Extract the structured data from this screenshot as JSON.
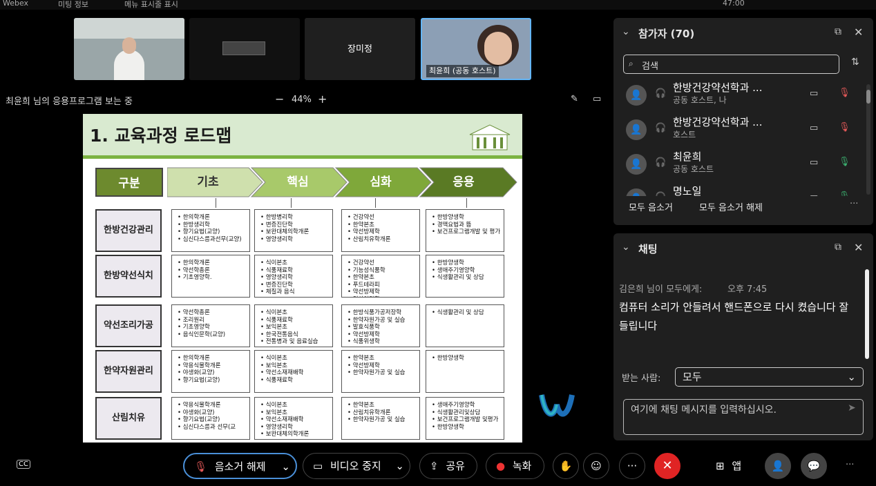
{
  "app": {
    "name": "Webex",
    "meeting_info": "미팅 정보",
    "menu_toggle": "메뉴 표시줄 표시",
    "timer": "47:00"
  },
  "thumbnails": [
    {
      "name": ""
    },
    {
      "name": ""
    },
    {
      "name": "장미정"
    },
    {
      "name": "최윤희 (공동 호스트)"
    }
  ],
  "stage": {
    "viewing": "최윤희 님의 응용프로그램 보는 중",
    "zoom": "44%"
  },
  "slide": {
    "title": "1. 교육과정 로드맵",
    "headers": [
      "구분",
      "기초",
      "핵심",
      "심화",
      "응용"
    ],
    "rows": [
      {
        "label": "한방건강관리",
        "cells": [
          [
            "한의학개론",
            "한방생리학",
            "향기요법(교양)",
            "심신다스름과선무(교양)"
          ],
          [
            "한방병리학",
            "변증진단학",
            "보완대체의학개론",
            "영양생리학"
          ],
          [
            "건강약선",
            "한약본초",
            "약선방제학",
            "산림치유학개론"
          ],
          [
            "한방양생학",
            "경맥요법과 뜸",
            "보건프로그램개발 및 평가"
          ]
        ]
      },
      {
        "label": "한방약선식치",
        "cells": [
          [
            "한의학개론",
            "약선학총론",
            "기초영양학."
          ],
          [
            "식이본초",
            "식품재료학",
            "영양생리학",
            "변증진단학",
            "체질과 음식"
          ],
          [
            "건강약선",
            "기능성식품학",
            "한약본초",
            "푸드테라피",
            "약선방제학",
            "임상영양학"
          ],
          [
            "한방양생학",
            "생애주기영양학",
            "식생활관리 및 상담"
          ]
        ]
      },
      {
        "label": "약선조리가공",
        "cells": [
          [
            "약선학총론",
            "조리원리",
            "기초영양학",
            "음식인문학(교양)"
          ],
          [
            "식이본초",
            "식품재료학",
            "보익본초",
            "한국전통음식",
            "전통병과 및 음료실습"
          ],
          [
            "한방식품가공저장학",
            "한약자원가공 및 실습",
            "발효식품학",
            "약선방제학",
            "식품위생학"
          ],
          [
            "식생활관리 및 상담"
          ]
        ]
      },
      {
        "label": "한약자원관리",
        "cells": [
          [
            "한의학개론",
            "약용식물학개론",
            "야생화(교양)",
            "향기요법(교양)"
          ],
          [
            "식이본초",
            "보익본초",
            "약선소재재배학",
            "식품재료학"
          ],
          [
            "한약본초",
            "약선방제학",
            "한약자원가공 및 실습"
          ],
          [
            "한방양생학"
          ]
        ]
      },
      {
        "label": "산림치유",
        "cells": [
          [
            "약용식물학개론",
            "야생화(교양)",
            "향기요법(교양)",
            "심신다스름과 선무(교"
          ],
          [
            "식이본초",
            "보익본초",
            "약선소재재배학",
            "영양생리학",
            "보완대체의학개론"
          ],
          [
            "한약본초",
            "산림치유학개론",
            "한약자원가공 및 실습"
          ],
          [
            "생애주기영양학",
            "식생활관리및상담",
            "보건프로그램개발 및평가",
            "한방양생학"
          ]
        ]
      }
    ]
  },
  "participants": {
    "title": "참가자 (70)",
    "search_placeholder": "검색",
    "list": [
      {
        "name": "한방건강약선학과 ...",
        "role": "공동 호스트, 나"
      },
      {
        "name": "한방건강약선학과 ...",
        "role": "호스트"
      },
      {
        "name": "최윤희",
        "role": "공동 호스트"
      },
      {
        "name": "명노일",
        "role": ""
      }
    ],
    "mute_all": "모두 음소거",
    "unmute_all": "모두 음소거 해제"
  },
  "chat": {
    "title": "채팅",
    "sender": "김은희 님이 모두에게:",
    "time": "오후 7:45",
    "message": "컴퓨터 소리가 안들려서 핸드폰으로 다시 켰습니다  잘들립니다",
    "to_label": "받는 사람:",
    "to_value": "모두",
    "input_placeholder": "여기에 채팅 메시지를 입력하십시오."
  },
  "controls": {
    "unmute": "음소거 해제",
    "stop_video": "비디오 중지",
    "share": "공유",
    "record": "녹화",
    "apps": "앱"
  }
}
